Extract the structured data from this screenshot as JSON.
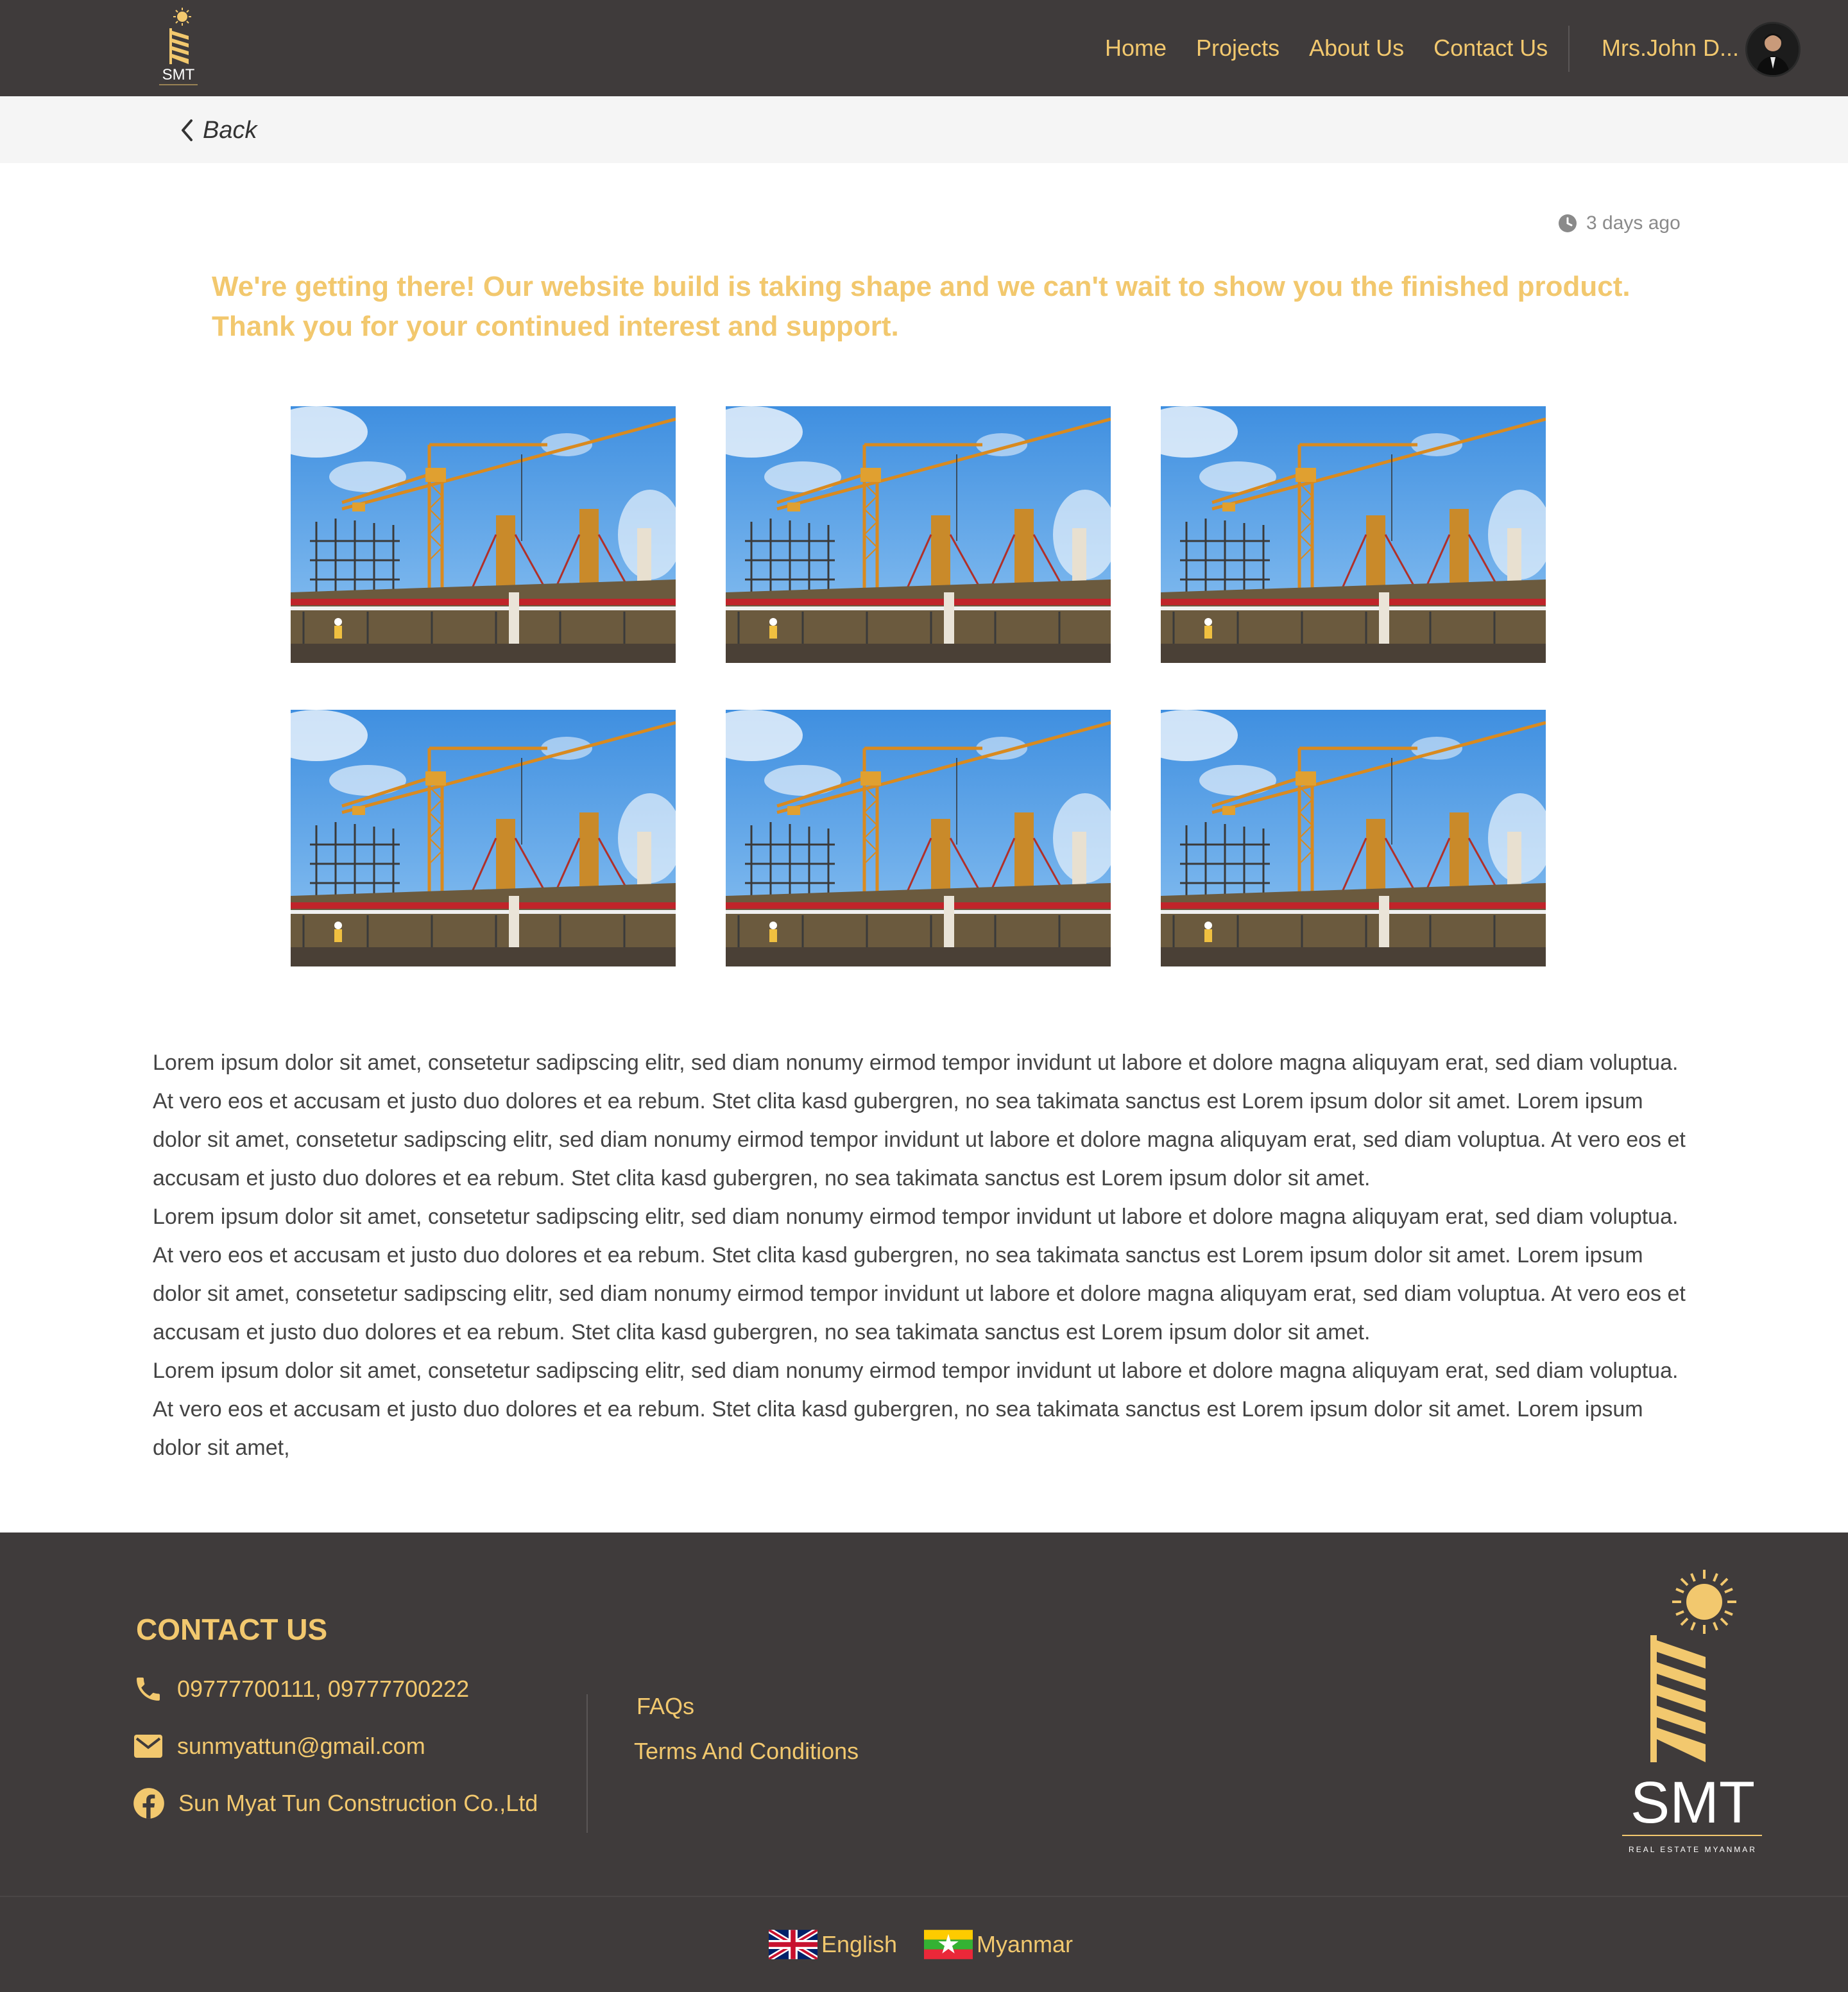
{
  "nav": {
    "logo_text": "SMT",
    "links": [
      "Home",
      "Projects",
      "About Us",
      "Contact Us"
    ],
    "user_name": "Mrs.John D...",
    "accent_color": "#f2c86e",
    "bg_color": "#3f3b3b"
  },
  "backbar": {
    "back_label": "Back"
  },
  "post": {
    "timestamp": "3 days ago",
    "headline_line1": "We're getting there! Our website build is taking shape and we can't wait to show you the finished product.",
    "headline_line2": "Thank you for your continued interest and support.",
    "paragraphs": [
      "Lorem ipsum dolor sit amet, consetetur sadipscing elitr, sed diam nonumy eirmod tempor invidunt ut labore et dolore magna aliquyam erat, sed diam voluptua. At vero eos et accusam et justo duo dolores et ea rebum. Stet clita kasd gubergren, no sea takimata sanctus est Lorem ipsum dolor sit amet. Lorem ipsum dolor sit amet, consetetur sadipscing elitr, sed diam nonumy eirmod tempor invidunt ut labore et dolore magna aliquyam erat, sed diam voluptua. At vero eos et accusam et justo duo dolores et ea rebum. Stet clita kasd gubergren, no sea takimata sanctus est Lorem ipsum dolor sit amet.",
      "Lorem ipsum dolor sit amet, consetetur sadipscing elitr, sed diam nonumy eirmod tempor invidunt ut labore et dolore magna aliquyam erat, sed diam voluptua. At vero eos et accusam et justo duo dolores et ea rebum. Stet clita kasd gubergren, no sea takimata sanctus est Lorem ipsum dolor sit amet. Lorem ipsum dolor sit amet, consetetur sadipscing elitr, sed diam nonumy eirmod tempor invidunt ut labore et dolore magna aliquyam erat, sed diam voluptua. At vero eos et accusam et justo duo dolores et ea rebum. Stet clita kasd gubergren, no sea takimata sanctus est Lorem ipsum dolor sit amet.",
      "Lorem ipsum dolor sit amet, consetetur sadipscing elitr, sed diam nonumy eirmod tempor invidunt ut labore et dolore magna aliquyam erat, sed diam voluptua. At vero eos et accusam et justo duo dolores et ea rebum. Stet clita kasd gubergren, no sea takimata sanctus est Lorem ipsum dolor sit amet. Lorem ipsum dolor sit amet,"
    ],
    "photo_count": 6
  },
  "footer": {
    "contact_title": "CONTACT US",
    "phone": "09777700111, 09777700222",
    "email": "sunmyattun@gmail.com",
    "facebook": "Sun Myat Tun Construction Co.,Ltd",
    "links": [
      "FAQs",
      "Terms And Conditions"
    ],
    "logo_text": "SMT",
    "logo_tagline": "REAL ESTATE MYANMAR"
  },
  "languages": [
    "English",
    "Myanmar"
  ]
}
